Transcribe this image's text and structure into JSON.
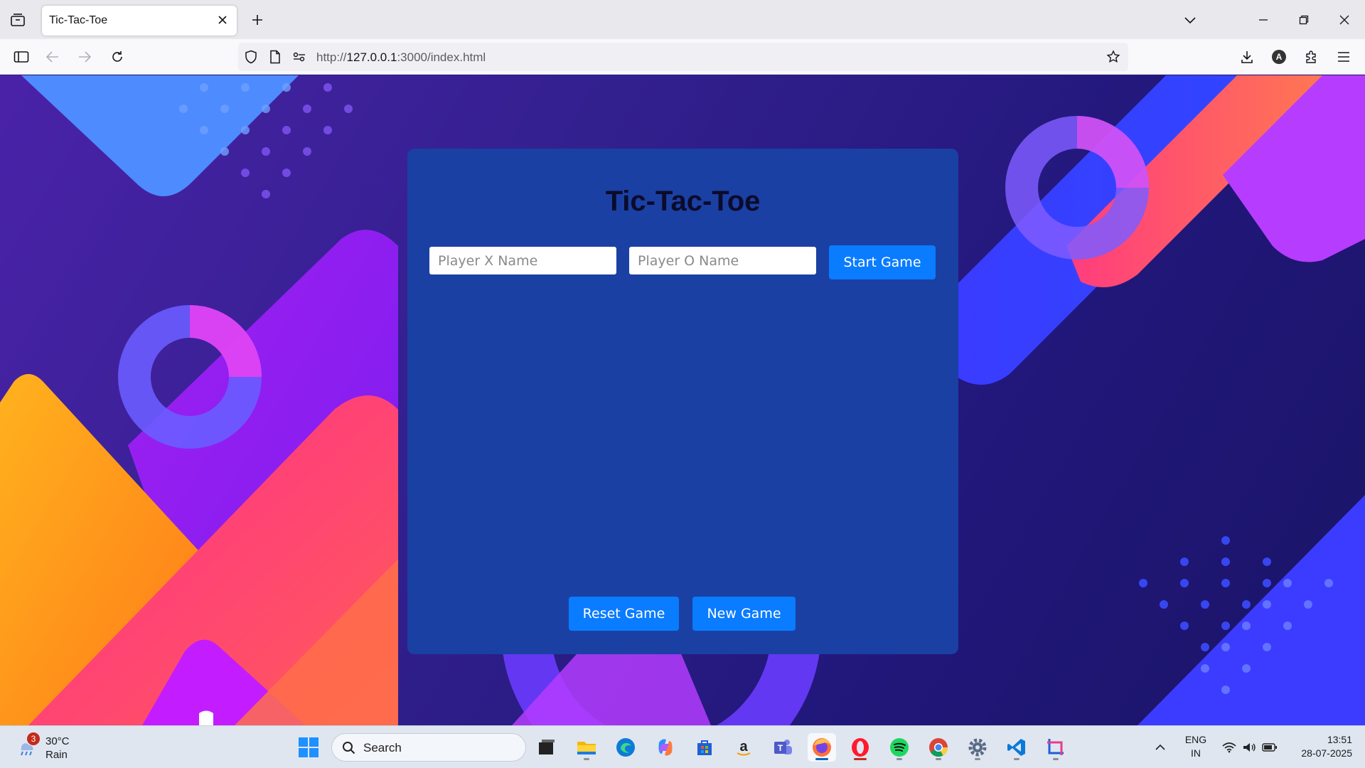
{
  "browser": {
    "tab_title": "Tic-Tac-Toe",
    "url_prefix": "http://",
    "url_host": "127.0.0.1",
    "url_path": ":3000/index.html",
    "profile_initial": "A"
  },
  "page": {
    "title": "Tic-Tac-Toe",
    "player_x_placeholder": "Player X Name",
    "player_o_placeholder": "Player O Name",
    "start_label": "Start Game",
    "reset_label": "Reset Game",
    "new_label": "New Game",
    "card_color": "#1a40a4",
    "button_color": "#0a7cff"
  },
  "taskbar": {
    "weather_badge": "3",
    "weather_temp": "30°C",
    "weather_cond": "Rain",
    "search_label": "Search",
    "lang_line1": "ENG",
    "lang_line2": "IN",
    "time": "13:51",
    "date": "28-07-2025",
    "apps": [
      "windows-start",
      "task-view",
      "file-explorer",
      "edge",
      "copilot",
      "microsoft-store",
      "amazon",
      "teams",
      "firefox",
      "opera",
      "spotify",
      "chrome",
      "settings",
      "vscode",
      "snipping-tool"
    ]
  }
}
